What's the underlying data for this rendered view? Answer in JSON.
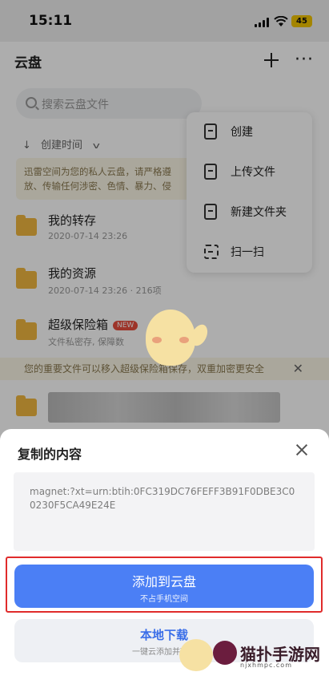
{
  "status_bar": {
    "time": "15:11",
    "battery": "45"
  },
  "header": {
    "title": "云盘"
  },
  "search": {
    "placeholder": "搜索云盘文件"
  },
  "sort": {
    "label": "创建时间"
  },
  "notice": {
    "line1": "迅雷空间为您的私人云盘，请严格遵",
    "line2": "放、传输任何涉密、色情、暴力、侵"
  },
  "menu": {
    "items": [
      {
        "label": "创建",
        "icon": "create-icon"
      },
      {
        "label": "上传文件",
        "icon": "upload-file-icon"
      },
      {
        "label": "新建文件夹",
        "icon": "new-folder-icon"
      },
      {
        "label": "扫一扫",
        "icon": "scan-icon"
      }
    ]
  },
  "files": [
    {
      "name": "我的转存",
      "meta": "2020-07-14 23:26"
    },
    {
      "name": "我的资源",
      "meta": "2020-07-14 23:26 · 216项"
    },
    {
      "name": "超级保险箱",
      "badge": "NEW",
      "meta": "文件私密存, 保障数"
    }
  ],
  "safe_banner": {
    "text": "您的重要文件可以移入超级保险箱保存，双重加密更安全"
  },
  "sheet": {
    "title": "复制的内容",
    "clipboard": "magnet:?xt=urn:btih:0FC319DC76FEFF3B91F0DBE3C00230F5CA49E24E",
    "primary_label": "添加到云盘",
    "primary_sub": "不占手机空间",
    "secondary_label": "本地下载",
    "secondary_sub": "一键云添加并下载"
  },
  "watermark": {
    "text": "猫扑手游网",
    "sub": "njxhmpc.com"
  },
  "colors": {
    "accent": "#4b7ff5",
    "highlight": "#e02b2b",
    "folder": "#f1b740"
  }
}
